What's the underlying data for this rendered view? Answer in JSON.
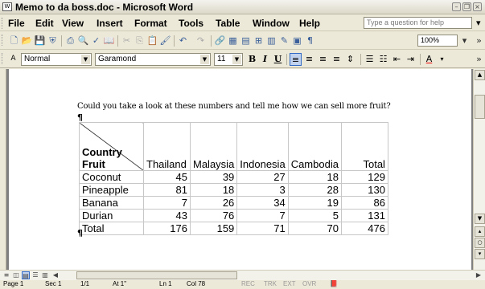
{
  "window": {
    "title": "Memo to da boss.doc - Microsoft Word"
  },
  "menu": {
    "items": [
      "File",
      "Edit",
      "View",
      "Insert",
      "Format",
      "Tools",
      "Table",
      "Window",
      "Help"
    ],
    "help_placeholder": "Type a question for help"
  },
  "toolbar": {
    "zoom": "100%"
  },
  "formatting": {
    "style": "Normal",
    "font": "Garamond",
    "size": "11",
    "bold": "B",
    "italic": "I",
    "underline": "U"
  },
  "document": {
    "text": "Could you take a look at these numbers and tell me how we can sell more fruit?",
    "pilcrow": "¶",
    "table": {
      "corner_top": "Country",
      "corner_bottom": "Fruit",
      "columns": [
        "Thailand",
        "Malaysia",
        "Indonesia",
        "Cambodia",
        "Total"
      ],
      "rows": [
        {
          "label": "Coconut",
          "values": [
            "45",
            "39",
            "27",
            "18",
            "129"
          ]
        },
        {
          "label": "Pineapple",
          "values": [
            "81",
            "18",
            "3",
            "28",
            "130"
          ]
        },
        {
          "label": "Banana",
          "values": [
            "7",
            "26",
            "34",
            "19",
            "86"
          ]
        },
        {
          "label": "Durian",
          "values": [
            "43",
            "76",
            "7",
            "5",
            "131"
          ]
        },
        {
          "label": "Total",
          "values": [
            "176",
            "159",
            "71",
            "70",
            "476"
          ]
        }
      ]
    }
  },
  "status": {
    "page": "Page 1",
    "sec": "Sec 1",
    "pages": "1/1",
    "at": "At 1\"",
    "ln": "Ln 1",
    "col": "Col 78",
    "rec": "REC",
    "trk": "TRK",
    "ext": "EXT",
    "ovr": "OVR"
  }
}
